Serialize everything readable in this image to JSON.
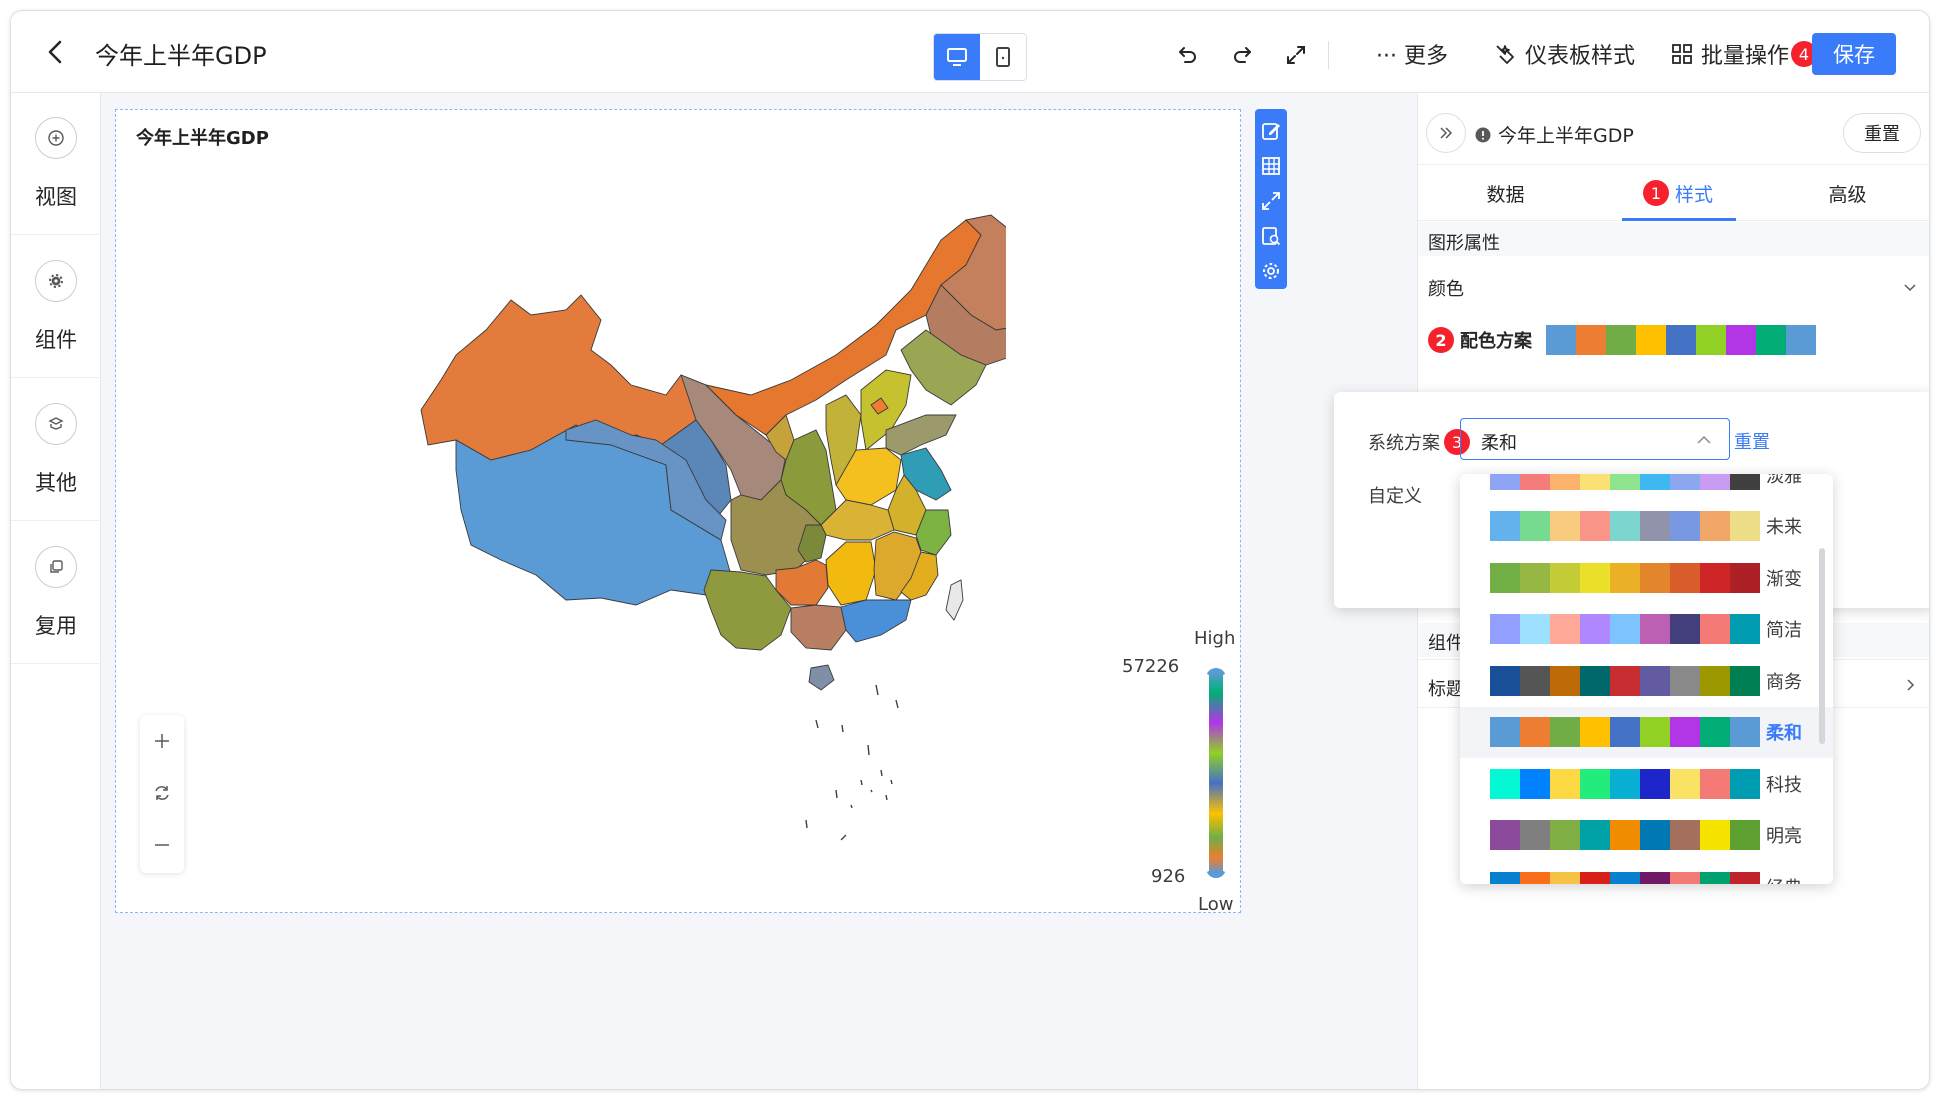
{
  "header": {
    "title": "今年上半年GDP",
    "more_label": "··· 更多",
    "dashboard_style_label": "仪表板样式",
    "batch_label": "批量操作",
    "batch_badge": "4",
    "save_label": "保存"
  },
  "rail": [
    {
      "label": "视图",
      "icon": "plus-circle-icon"
    },
    {
      "label": "组件",
      "icon": "gear-icon"
    },
    {
      "label": "其他",
      "icon": "layers-icon"
    },
    {
      "label": "复用",
      "icon": "copy-icon"
    }
  ],
  "card": {
    "title": "今年上半年GDP",
    "legend": {
      "high": "High",
      "low": "Low",
      "max": "57226",
      "min": "926"
    }
  },
  "panel": {
    "name": "今年上半年GDP",
    "reset_label": "重置",
    "tabs": [
      {
        "label": "数据"
      },
      {
        "label": "样式",
        "badge": "1"
      },
      {
        "label": "高级"
      }
    ],
    "section_shape": "图形属性",
    "color_label": "颜色",
    "scheme_label": "配色方案",
    "scheme_badge": "2",
    "section_component": "组件",
    "title_row": "标题"
  },
  "popover": {
    "system_label": "系统方案",
    "system_badge": "3",
    "selected": "柔和",
    "reset_label": "重置",
    "custom_label": "自定义"
  },
  "palettes": [
    {
      "name": "淡雅",
      "colors": [
        "#8fa4f5",
        "#f47c7c",
        "#fbb36b",
        "#f9e273",
        "#8ee38c",
        "#3eb8f0",
        "#8ca6f0",
        "#c99cf2",
        "#404040"
      ]
    },
    {
      "name": "未来",
      "colors": [
        "#63b2ee",
        "#76da91",
        "#f8cb7f",
        "#f89588",
        "#7cd6cf",
        "#9192ab",
        "#7898e1",
        "#efa666",
        "#eddd86"
      ]
    },
    {
      "name": "渐变",
      "colors": [
        "#71ae46",
        "#96b744",
        "#c4cc38",
        "#ebe12a",
        "#eab026",
        "#e3852b",
        "#d85d2a",
        "#ce2626",
        "#ac2026"
      ]
    },
    {
      "name": "简洁",
      "colors": [
        "#929fff",
        "#9de0ff",
        "#ffa897",
        "#af87fe",
        "#7dc3fe",
        "#bb60b2",
        "#433e7c",
        "#f47a75",
        "#009db2"
      ]
    },
    {
      "name": "商务",
      "colors": [
        "#194f97",
        "#555555",
        "#bd6b08",
        "#00686b",
        "#c82d31",
        "#625ba1",
        "#898989",
        "#9c9800",
        "#007f54"
      ]
    },
    {
      "name": "柔和",
      "colors": [
        "#5b9bd5",
        "#ed7d31",
        "#70ad47",
        "#ffc000",
        "#4472c4",
        "#91d024",
        "#b235e6",
        "#02ae75",
        "#5b9bd5"
      ]
    },
    {
      "name": "科技",
      "colors": [
        "#05f8d6",
        "#0082fc",
        "#fdd845",
        "#22ed7c",
        "#09b0d3",
        "#1d27c9",
        "#f9e264",
        "#f47a75",
        "#009db2"
      ]
    },
    {
      "name": "明亮",
      "colors": [
        "#8b4a9c",
        "#7f7f7f",
        "#7fae45",
        "#00a2a8",
        "#f08c00",
        "#0078b4",
        "#a2705c",
        "#f6e400",
        "#5fa032"
      ]
    },
    {
      "name": "经典",
      "colors": [
        "#0780cf",
        "#fa6d1d",
        "#f6c344",
        "#da1f18",
        "#0780cf",
        "#701866",
        "#f47a75",
        "#01a06f",
        "#c1232b"
      ]
    }
  ],
  "colors": {
    "accent": "#3a7bfa",
    "badge": "#f5222d"
  }
}
